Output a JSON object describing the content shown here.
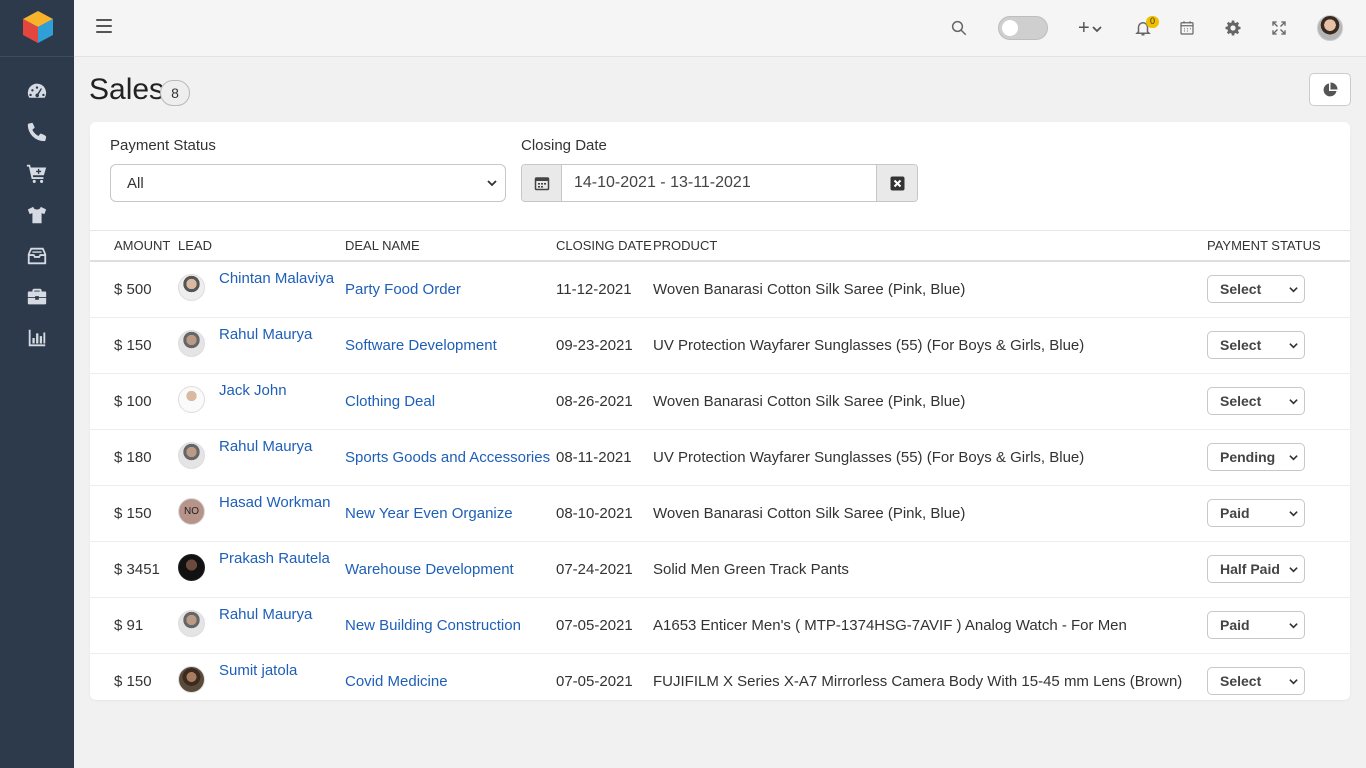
{
  "sidebar": {
    "items": [
      {
        "name": "dashboard-icon"
      },
      {
        "name": "phone-icon"
      },
      {
        "name": "cart-icon"
      },
      {
        "name": "tshirt-icon"
      },
      {
        "name": "inbox-icon"
      },
      {
        "name": "briefcase-icon"
      },
      {
        "name": "bar-chart-icon"
      }
    ]
  },
  "topbar": {
    "notification_count": "0",
    "plus_label": "+"
  },
  "page": {
    "title": "Sales",
    "count": "8"
  },
  "filters": {
    "payment_status_label": "Payment Status",
    "payment_status_value": "All",
    "closing_date_label": "Closing Date",
    "closing_date_value": "14-10-2021 - 13-11-2021"
  },
  "table": {
    "headers": {
      "amount": "AMOUNT",
      "lead": "LEAD",
      "deal_name": "DEAL NAME",
      "closing_date": "CLOSING DATE",
      "product": "PRODUCT",
      "payment_status": "PAYMENT STATUS"
    },
    "rows": [
      {
        "amount": "$ 500",
        "lead": "Chintan Malaviya",
        "avatar": "",
        "deal": "Party Food Order",
        "date": "11-12-2021",
        "product": "Woven Banarasi Cotton Silk Saree (Pink, Blue)",
        "status": "Select"
      },
      {
        "amount": "$ 150",
        "lead": "Rahul Maurya",
        "avatar": "",
        "deal": "Software Development",
        "date": "09-23-2021",
        "product": "UV Protection Wayfarer Sunglasses (55) (For Boys & Girls, Blue)",
        "status": "Select"
      },
      {
        "amount": "$ 100",
        "lead": "Jack John",
        "avatar": "",
        "deal": "Clothing Deal",
        "date": "08-26-2021",
        "product": "Woven Banarasi Cotton Silk Saree (Pink, Blue)",
        "status": "Select"
      },
      {
        "amount": "$ 180",
        "lead": "Rahul Maurya",
        "avatar": "",
        "deal": "Sports Goods and Accessories",
        "date": "08-11-2021",
        "product": "UV Protection Wayfarer Sunglasses (55) (For Boys & Girls, Blue)",
        "status": "Pending"
      },
      {
        "amount": "$ 150",
        "lead": "Hasad Workman",
        "avatar": "NO",
        "deal": "New Year Even Organize",
        "date": "08-10-2021",
        "product": "Woven Banarasi Cotton Silk Saree (Pink, Blue)",
        "status": "Paid"
      },
      {
        "amount": "$ 3451",
        "lead": "Prakash Rautela",
        "avatar": "",
        "deal": "Warehouse Development",
        "date": "07-24-2021",
        "product": "Solid Men Green Track Pants",
        "status": "Half Paid"
      },
      {
        "amount": "$ 91",
        "lead": "Rahul Maurya",
        "avatar": "",
        "deal": "New Building Construction",
        "date": "07-05-2021",
        "product": "A1653 Enticer Men's ( MTP-1374HSG-7AVIF ) Analog Watch - For Men",
        "status": "Paid"
      },
      {
        "amount": "$ 150",
        "lead": "Sumit jatola",
        "avatar": "",
        "deal": "Covid Medicine",
        "date": "07-05-2021",
        "product": "FUJIFILM X Series X-A7 Mirrorless Camera Body With 15-45 mm Lens (Brown)",
        "status": "Select"
      }
    ]
  },
  "colors": {
    "sidebar_bg": "#2d3a4b",
    "link": "#1e5fb8",
    "badge": "#f0c000"
  }
}
